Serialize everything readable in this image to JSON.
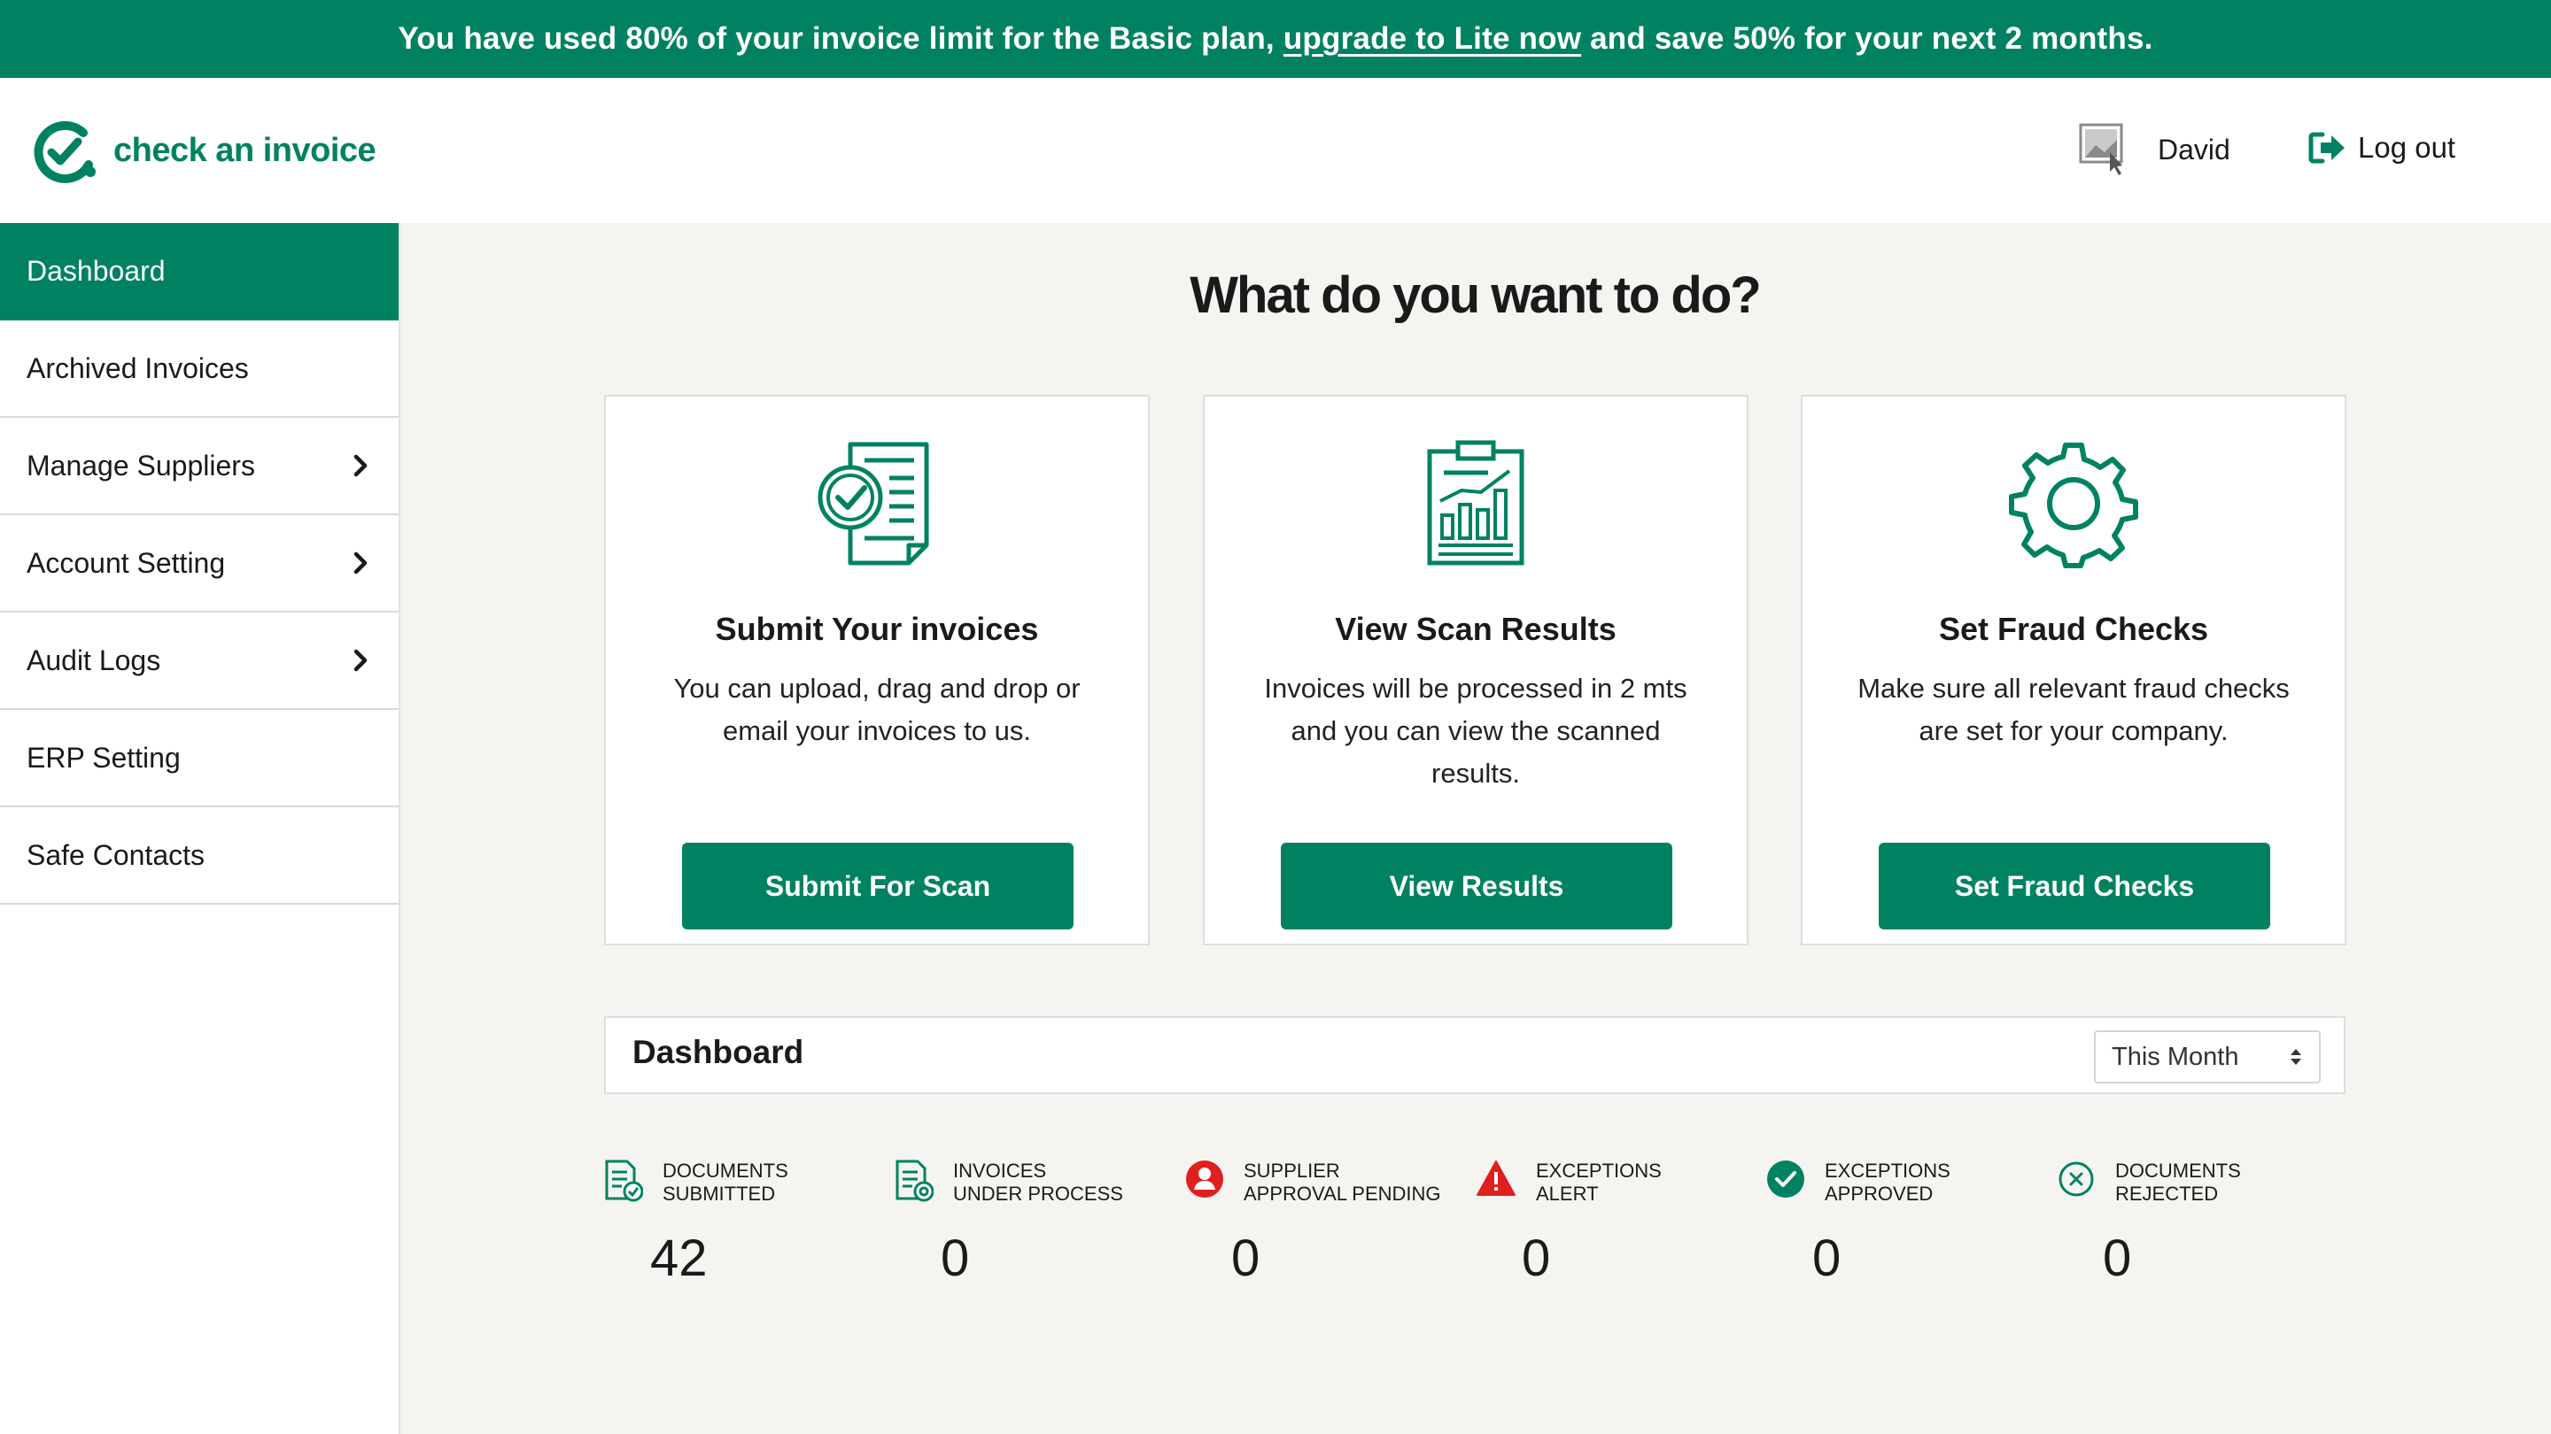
{
  "banner": {
    "text_before": "You have used 80% of your invoice limit for the Basic plan,",
    "link": "upgrade to Lite now",
    "text_after": "and save 50% for your next 2 months."
  },
  "header": {
    "logo_text": "check an invoice",
    "user_name": "David",
    "logout_label": "Log out"
  },
  "sidebar": {
    "items": [
      {
        "label": "Dashboard"
      },
      {
        "label": "Archived Invoices"
      },
      {
        "label": "Manage Suppliers"
      },
      {
        "label": "Account Setting"
      },
      {
        "label": "Audit Logs"
      },
      {
        "label": "ERP Setting"
      },
      {
        "label": "Safe Contacts"
      }
    ]
  },
  "main": {
    "title": "What do you want to do?",
    "cards": [
      {
        "title": "Submit Your invoices",
        "desc": "You can upload, drag and drop or email your invoices to us.",
        "button": "Submit For Scan"
      },
      {
        "title": "View Scan Results",
        "desc": "Invoices will be processed in 2 mts and you can view the scanned results.",
        "button": "View Results"
      },
      {
        "title": "Set Fraud Checks",
        "desc": "Make sure all relevant fraud checks are set for your company.",
        "button": "Set Fraud Checks"
      }
    ]
  },
  "dashboard": {
    "title": "Dashboard",
    "period": "This Month",
    "stats": [
      {
        "label_1": "DOCUMENTS",
        "label_2": "SUBMITTED",
        "value": "42",
        "icon": "document-check-icon"
      },
      {
        "label_1": "INVOICES",
        "label_2": "UNDER PROCESS",
        "value": "0",
        "icon": "document-gear-icon"
      },
      {
        "label_1": "SUPPLIER",
        "label_2": "APPROVAL PENDING",
        "value": "0",
        "icon": "user-alert-icon"
      },
      {
        "label_1": "EXCEPTIONS",
        "label_2": "ALERT",
        "value": "0",
        "icon": "warning-icon"
      },
      {
        "label_1": "EXCEPTIONS",
        "label_2": "APPROVED",
        "value": "0",
        "icon": "check-circle-icon"
      },
      {
        "label_1": "DOCUMENTS",
        "label_2": "REJECTED",
        "value": "0",
        "icon": "x-circle-icon"
      }
    ]
  },
  "colors": {
    "brand": "#008262",
    "alert": "#e0201f"
  }
}
